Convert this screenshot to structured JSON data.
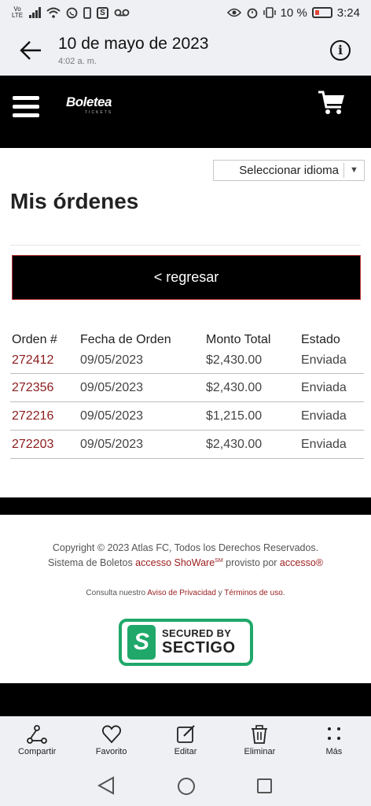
{
  "status_bar": {
    "volte": "Vo LTE",
    "battery": "10 %",
    "time": "3:24"
  },
  "viewer": {
    "date": "10 de mayo de 2023",
    "time": "4:02 a. m."
  },
  "site": {
    "logo_text": "Boletea",
    "logo_sub": "TICKETS"
  },
  "language": {
    "label": "Seleccionar idioma"
  },
  "page": {
    "title": "Mis órdenes",
    "back_label": "< regresar"
  },
  "orders": {
    "headers": [
      "Orden #",
      "Fecha de Orden",
      "Monto Total",
      "Estado"
    ],
    "rows": [
      {
        "order": "272412",
        "date": "09/05/2023",
        "amount": "$2,430.00",
        "status": "Enviada"
      },
      {
        "order": "272356",
        "date": "09/05/2023",
        "amount": "$2,430.00",
        "status": "Enviada"
      },
      {
        "order": "272216",
        "date": "09/05/2023",
        "amount": "$1,215.00",
        "status": "Enviada"
      },
      {
        "order": "272203",
        "date": "09/05/2023",
        "amount": "$2,430.00",
        "status": "Enviada"
      }
    ]
  },
  "footer": {
    "copyright": "Copyright © 2023 Atlas FC, Todos los Derechos Reservados.",
    "system_prefix": "Sistema de Boletos ",
    "system_link": "accesso ShoWare",
    "system_sup": "SM",
    "system_mid": " provisto por ",
    "system_link2": "accesso®",
    "privacy_prefix": "Consulta nuestro ",
    "privacy_link": "Aviso de Privacidad",
    "privacy_mid": " y ",
    "terms_link": "Términos de uso",
    "privacy_suffix": ".",
    "seal_line1": "SECURED BY",
    "seal_line2": "SECTIGO"
  },
  "actions": [
    {
      "label": "Compartir"
    },
    {
      "label": "Favorito"
    },
    {
      "label": "Editar"
    },
    {
      "label": "Eliminar"
    },
    {
      "label": "Más"
    }
  ],
  "colors": {
    "accent_red": "#8b1c1c",
    "sectigo_green": "#1fa86a"
  }
}
